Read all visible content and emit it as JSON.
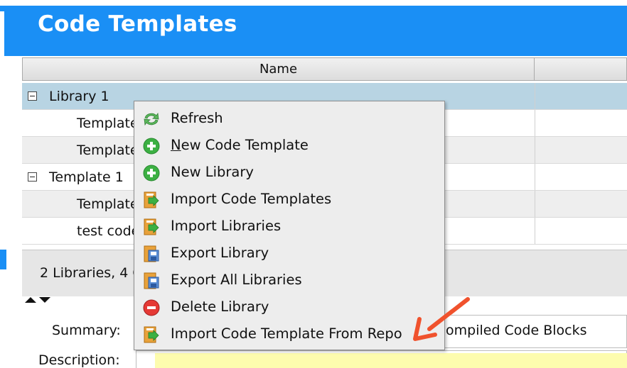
{
  "header": {
    "title": "Code Templates"
  },
  "table": {
    "columns": [
      "Name",
      ""
    ],
    "rows": [
      {
        "label": "Library 1",
        "type": "library",
        "expanded": true,
        "selected": true
      },
      {
        "label": "Template",
        "type": "template"
      },
      {
        "label": "Template",
        "type": "template"
      },
      {
        "label": "Template 1",
        "type": "library",
        "expanded": true
      },
      {
        "label": "Template",
        "type": "template"
      },
      {
        "label": "test code",
        "type": "template"
      }
    ]
  },
  "status_bar": {
    "text": "2 Libraries, 4 C"
  },
  "detail": {
    "summary_label": "Summary:",
    "summary_value": "ompiled Code Blocks",
    "description_label": "Description:",
    "description_value": ""
  },
  "context_menu": {
    "items": [
      {
        "label": "Refresh",
        "icon": "refresh-icon"
      },
      {
        "label_mnemonic": "N",
        "label_rest": "ew Code Template",
        "icon": "add-icon"
      },
      {
        "label": "New Library",
        "icon": "add-icon"
      },
      {
        "label": "Import Code Templates",
        "icon": "import-icon"
      },
      {
        "label": "Import Libraries",
        "icon": "import-icon"
      },
      {
        "label": "Export Library",
        "icon": "export-icon"
      },
      {
        "label": "Export All Libraries",
        "icon": "export-icon"
      },
      {
        "label": "Delete Library",
        "icon": "delete-icon"
      },
      {
        "label": "Import Code Template From Repo",
        "icon": "import-icon"
      }
    ]
  },
  "colors": {
    "header_blue": "#1a8ff5",
    "selected_row": "#b8d4e3",
    "menu_bg": "#ededed",
    "annotation_arrow": "#f0522d",
    "add_green": "#3cb043",
    "delete_red": "#e53935",
    "description_yellow": "#fdfcae"
  }
}
